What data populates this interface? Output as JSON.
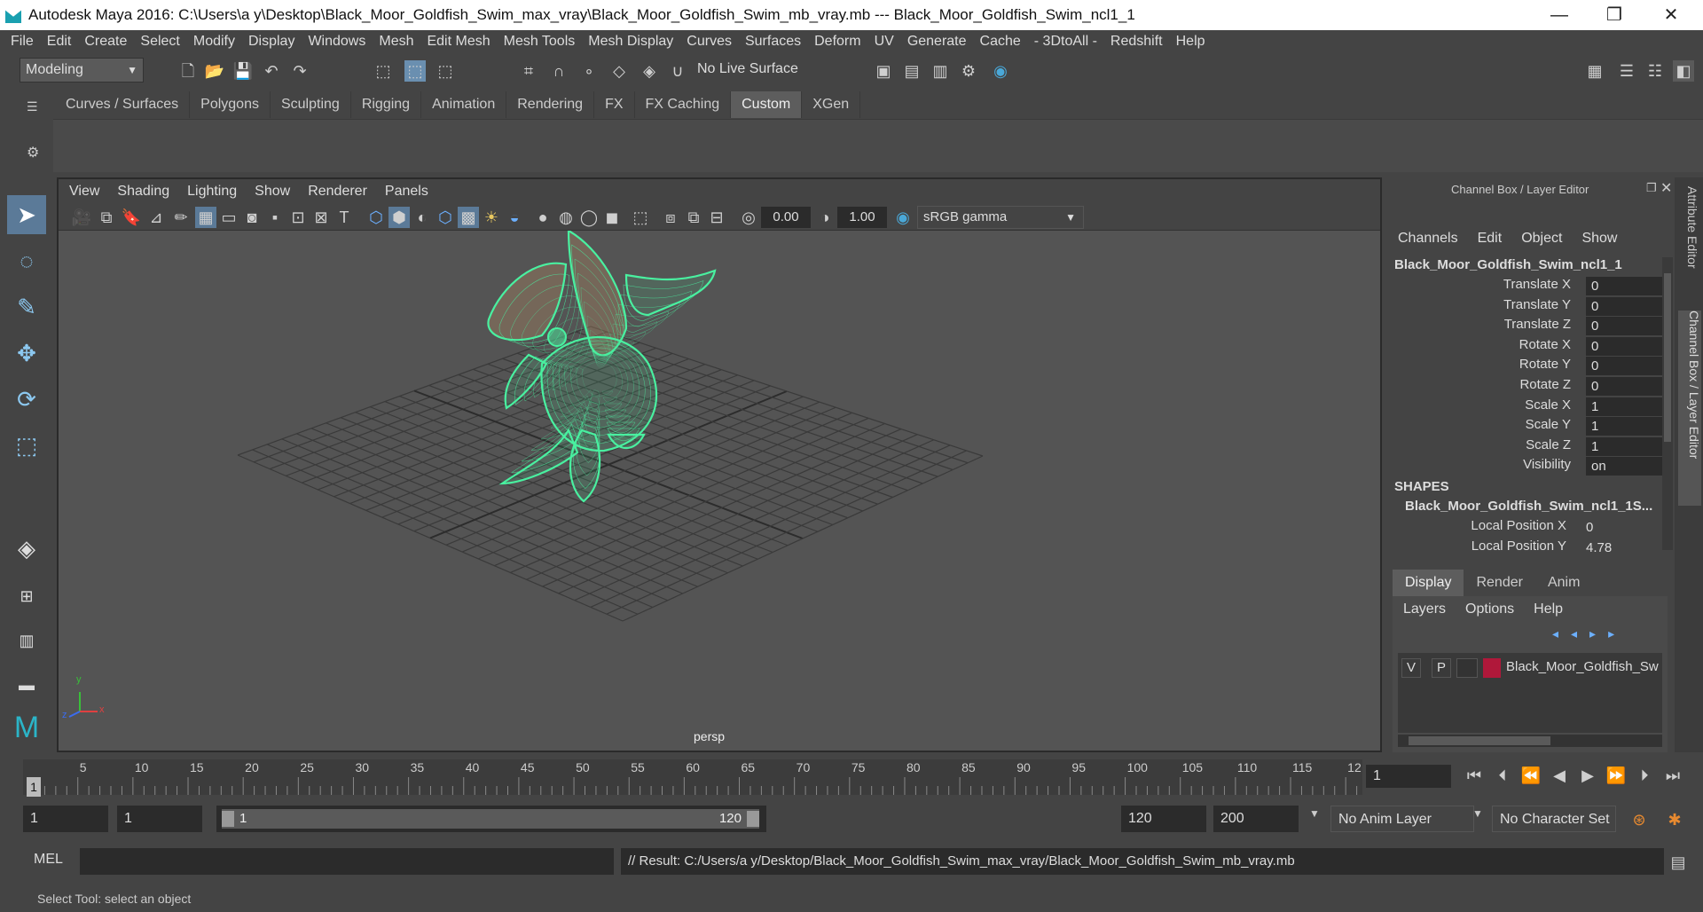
{
  "window": {
    "title": "Autodesk Maya 2016: C:\\Users\\a y\\Desktop\\Black_Moor_Goldfish_Swim_max_vray\\Black_Moor_Goldfish_Swim_mb_vray.mb   ---   Black_Moor_Goldfish_Swim_ncl1_1",
    "minimize": "—",
    "maximize": "❐",
    "close": "✕"
  },
  "menubar": [
    "File",
    "Edit",
    "Create",
    "Select",
    "Modify",
    "Display",
    "Windows",
    "Mesh",
    "Edit Mesh",
    "Mesh Tools",
    "Mesh Display",
    "Curves",
    "Surfaces",
    "Deform",
    "UV",
    "Generate",
    "Cache",
    "- 3DtoAll -",
    "Redshift",
    "Help"
  ],
  "statusline": {
    "mode": "Modeling",
    "live_surface": "No Live Surface"
  },
  "shelf": {
    "tabs": [
      "Curves / Surfaces",
      "Polygons",
      "Sculpting",
      "Rigging",
      "Animation",
      "Rendering",
      "FX",
      "FX Caching",
      "Custom",
      "XGen"
    ],
    "active": "Custom"
  },
  "viewport": {
    "menu": [
      "View",
      "Shading",
      "Lighting",
      "Show",
      "Renderer",
      "Panels"
    ],
    "exposure": "0.00",
    "gamma": "1.00",
    "color_space": "sRGB gamma",
    "camera_label": "persp",
    "axis_y": "y",
    "axis_x": "x",
    "axis_z": "z",
    "wire_color": "#49f0a0"
  },
  "channelbox": {
    "title": "Channel Box / Layer Editor",
    "menu": [
      "Channels",
      "Edit",
      "Object",
      "Show"
    ],
    "object": "Black_Moor_Goldfish_Swim_ncl1_1",
    "channels": [
      {
        "label": "Translate X",
        "value": "0"
      },
      {
        "label": "Translate Y",
        "value": "0"
      },
      {
        "label": "Translate Z",
        "value": "0"
      },
      {
        "label": "Rotate X",
        "value": "0"
      },
      {
        "label": "Rotate Y",
        "value": "0"
      },
      {
        "label": "Rotate Z",
        "value": "0"
      },
      {
        "label": "Scale X",
        "value": "1"
      },
      {
        "label": "Scale Y",
        "value": "1"
      },
      {
        "label": "Scale Z",
        "value": "1"
      },
      {
        "label": "Visibility",
        "value": "on"
      }
    ],
    "shapes_header": "SHAPES",
    "shape_name": "Black_Moor_Goldfish_Swim_ncl1_1S...",
    "shape_channels": [
      {
        "label": "Local Position X",
        "value": "0"
      },
      {
        "label": "Local Position Y",
        "value": "4.78"
      }
    ],
    "layer_tabs": [
      "Display",
      "Render",
      "Anim"
    ],
    "layer_menu": [
      "Layers",
      "Options",
      "Help"
    ],
    "layer": {
      "v": "V",
      "p": "P",
      "name": "Black_Moor_Goldfish_Sw",
      "color": "#b0183a"
    }
  },
  "side_tabs": [
    "Attribute Editor",
    "Channel Box / Layer Editor"
  ],
  "timeline": {
    "ticks": [
      "5",
      "10",
      "15",
      "20",
      "25",
      "30",
      "35",
      "40",
      "45",
      "50",
      "55",
      "60",
      "65",
      "70",
      "75",
      "80",
      "85",
      "90",
      "95",
      "100",
      "105",
      "110",
      "115",
      "12"
    ],
    "current_frame_marker": "1",
    "current_frame": "1"
  },
  "range": {
    "start": "1",
    "playback_start": "1",
    "slider_start": "1",
    "slider_end": "120",
    "playback_end": "120",
    "end": "200",
    "anim_layer": "No Anim Layer",
    "character_set": "No Character Set"
  },
  "cmdline": {
    "lang": "MEL",
    "result": "// Result: C:/Users/a y/Desktop/Black_Moor_Goldfish_Swim_max_vray/Black_Moor_Goldfish_Swim_mb_vray.mb"
  },
  "helpline": "Select Tool: select an object"
}
